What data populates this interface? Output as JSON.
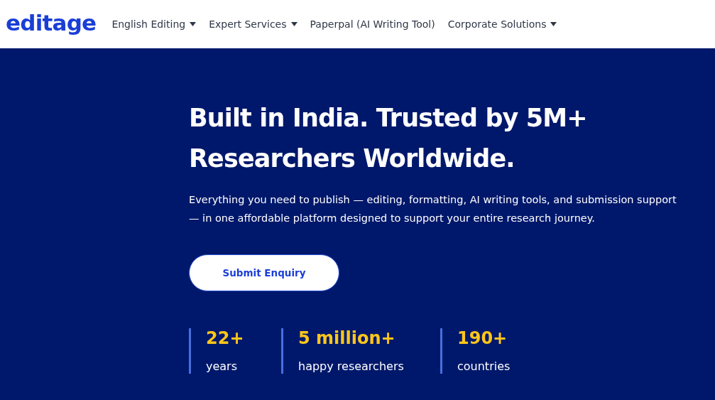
{
  "header": {
    "logo": "editage",
    "nav": [
      {
        "label": "English Editing",
        "has_menu": true
      },
      {
        "label": "Expert Services",
        "has_menu": true
      },
      {
        "label": "Paperpal (AI Writing Tool)",
        "has_menu": false
      },
      {
        "label": "Corporate Solutions",
        "has_menu": true
      }
    ]
  },
  "hero": {
    "title_lines": [
      "Built in India. Trusted by 5M+",
      "Researchers Worldwide."
    ],
    "subtitle": "Everything you need to publish — editing, formatting, AI writing tools, and submission support — in one affordable platform designed to support your entire research journey.",
    "button": "Submit Enquiry",
    "stats": [
      {
        "value": "22+",
        "label": "years"
      },
      {
        "value": "5 million+",
        "label": "happy researchers"
      },
      {
        "value": "190+",
        "label": "countries"
      }
    ]
  }
}
